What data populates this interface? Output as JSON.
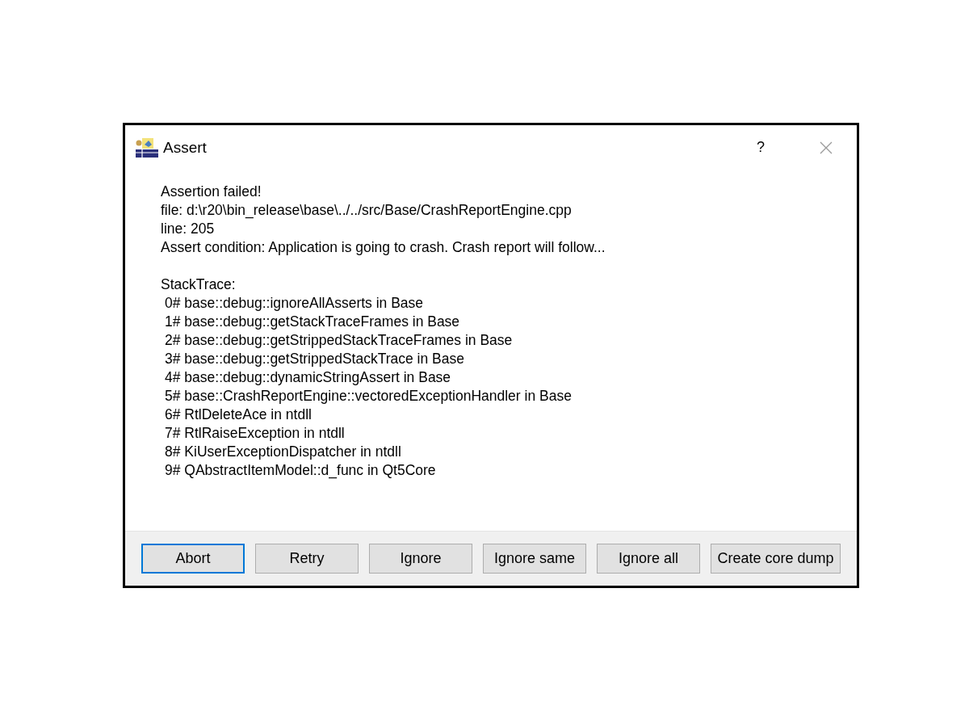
{
  "window": {
    "title": "Assert",
    "help": "?"
  },
  "message": [
    "Assertion failed!",
    "file: d:\\r20\\bin_release\\base\\../../src/Base/CrashReportEngine.cpp",
    "line: 205",
    "Assert condition: Application is going to crash. Crash report will follow..."
  ],
  "stack_trace": {
    "heading": "StackTrace:",
    "frames": [
      "0# base::debug::ignoreAllAsserts in Base",
      "1# base::debug::getStackTraceFrames in Base",
      "2# base::debug::getStrippedStackTraceFrames in Base",
      "3# base::debug::getStrippedStackTrace in Base",
      "4# base::debug::dynamicStringAssert in Base",
      "5# base::CrashReportEngine::vectoredExceptionHandler in Base",
      "6# RtlDeleteAce in ntdll",
      "7# RtlRaiseException in ntdll",
      "8# KiUserExceptionDispatcher in ntdll",
      "9# QAbstractItemModel::d_func in Qt5Core"
    ]
  },
  "buttons": [
    {
      "label": "Abort",
      "default": true
    },
    {
      "label": "Retry",
      "default": false
    },
    {
      "label": "Ignore",
      "default": false
    },
    {
      "label": "Ignore same",
      "default": false
    },
    {
      "label": "Ignore all",
      "default": false
    },
    {
      "label": "Create core dump",
      "default": false
    }
  ]
}
